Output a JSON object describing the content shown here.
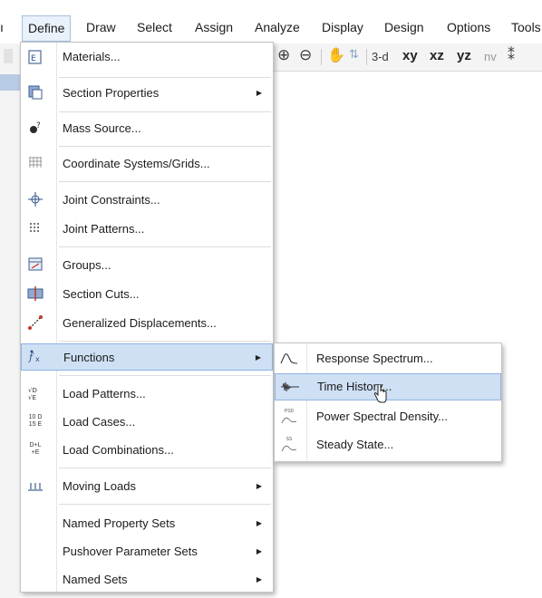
{
  "window": {
    "title_fragment": ""
  },
  "menubar": {
    "items": [
      {
        "label": "Define",
        "active": true
      },
      {
        "label": "Draw"
      },
      {
        "label": "Select"
      },
      {
        "label": "Assign"
      },
      {
        "label": "Analyze"
      },
      {
        "label": "Display"
      },
      {
        "label": "Design"
      },
      {
        "label": "Options"
      },
      {
        "label": "Tools"
      }
    ]
  },
  "toolbar": {
    "view_3d": "3-d",
    "view_xy": "xy",
    "view_xz": "xz",
    "view_yz": "yz",
    "view_nv": "nv"
  },
  "define_menu": {
    "items": [
      {
        "label": "Materials...",
        "icon": "materials-icon"
      },
      {
        "label": "Section Properties",
        "icon": "section-properties-icon",
        "submenu": true
      },
      {
        "label": "Mass Source...",
        "icon": "mass-source-icon"
      },
      {
        "label": "Coordinate Systems/Grids...",
        "icon": "grid-icon"
      },
      {
        "label": "Joint Constraints...",
        "icon": "joint-constraints-icon"
      },
      {
        "label": "Joint Patterns...",
        "icon": "joint-patterns-icon"
      },
      {
        "label": "Groups...",
        "icon": "groups-icon"
      },
      {
        "label": "Section Cuts...",
        "icon": "section-cuts-icon"
      },
      {
        "label": "Generalized Displacements...",
        "icon": "generalized-displacements-icon"
      },
      {
        "label": "Functions",
        "icon": "functions-icon",
        "submenu": true,
        "highlighted": true
      },
      {
        "label": "Load Patterns...",
        "icon": "load-patterns-icon"
      },
      {
        "label": "Load Cases...",
        "icon": "load-cases-icon"
      },
      {
        "label": "Load Combinations...",
        "icon": "load-combinations-icon"
      },
      {
        "label": "Moving Loads",
        "icon": "moving-loads-icon",
        "submenu": true
      },
      {
        "label": "Named Property Sets",
        "submenu": true
      },
      {
        "label": "Pushover Parameter Sets",
        "submenu": true
      },
      {
        "label": "Named Sets",
        "submenu": true
      }
    ]
  },
  "functions_submenu": {
    "items": [
      {
        "label": "Response Spectrum...",
        "icon": "response-spectrum-icon"
      },
      {
        "label": "Time History...",
        "icon": "time-history-icon",
        "highlighted": true
      },
      {
        "label": "Power Spectral Density...",
        "icon": "power-spectral-density-icon"
      },
      {
        "label": "Steady State...",
        "icon": "steady-state-icon"
      }
    ]
  },
  "icon_glyphs": {
    "lbl_10d": "10 D",
    "lbl_15e": "15 E",
    "lbl_dl": "D+L",
    "lbl_e": "+E",
    "psd": "PSD",
    "ss": "SS"
  }
}
